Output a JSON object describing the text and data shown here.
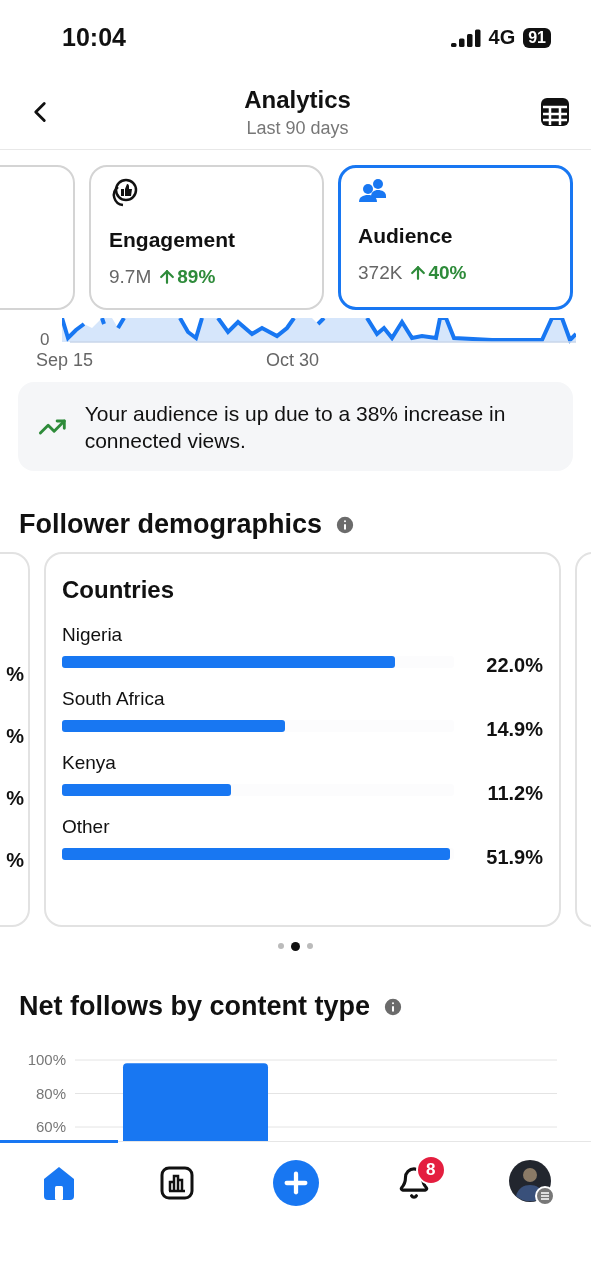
{
  "status_bar": {
    "time": "10:04",
    "network": "4G",
    "battery": "91"
  },
  "header": {
    "title": "Analytics",
    "subtitle": "Last 90 days"
  },
  "metric_cards": [
    {
      "kind": "partial",
      "selected": false
    },
    {
      "kind": "engagement",
      "title": "Engagement",
      "value": "9.7M",
      "change": "89%",
      "selected": false
    },
    {
      "kind": "audience",
      "title": "Audience",
      "value": "372K",
      "change": "40%",
      "selected": true
    }
  ],
  "sparkline": {
    "axis_label": "0",
    "dates": [
      "Sep 15",
      "Oct 30"
    ]
  },
  "insight": {
    "text": "Your audience is up due to a 38% increase in connected views."
  },
  "demographics": {
    "title": "Follower demographics",
    "previous_card_values": [
      "%",
      "%",
      "%",
      "%"
    ],
    "card": {
      "title": "Countries",
      "rows": [
        {
          "label": "Nigeria",
          "value": "22.0%",
          "level": 0.85
        },
        {
          "label": "South Africa",
          "value": "14.9%",
          "level": 0.57
        },
        {
          "label": "Kenya",
          "value": "11.2%",
          "level": 0.43
        },
        {
          "label": "Other",
          "value": "51.9%",
          "level": 0.99
        }
      ]
    },
    "pages": [
      {
        "selected": false
      },
      {
        "selected": true
      },
      {
        "selected": false
      }
    ]
  },
  "net_follows": {
    "title": "Net follows by content type",
    "chart_data": {
      "type": "bar",
      "values": [
        98
      ],
      "ylim": [
        52,
        100
      ],
      "yticks": [
        {
          "value": 60,
          "label": "60%"
        },
        {
          "value": 80,
          "label": "80%"
        },
        {
          "value": 100,
          "label": "100%"
        }
      ]
    }
  },
  "nav": {
    "items": [
      {
        "kind": "home",
        "selected": true
      },
      {
        "kind": "insights",
        "selected": false
      },
      {
        "kind": "create",
        "selected": false
      },
      {
        "kind": "notifications",
        "selected": false,
        "badge": "8"
      },
      {
        "kind": "profile",
        "selected": false
      }
    ]
  }
}
